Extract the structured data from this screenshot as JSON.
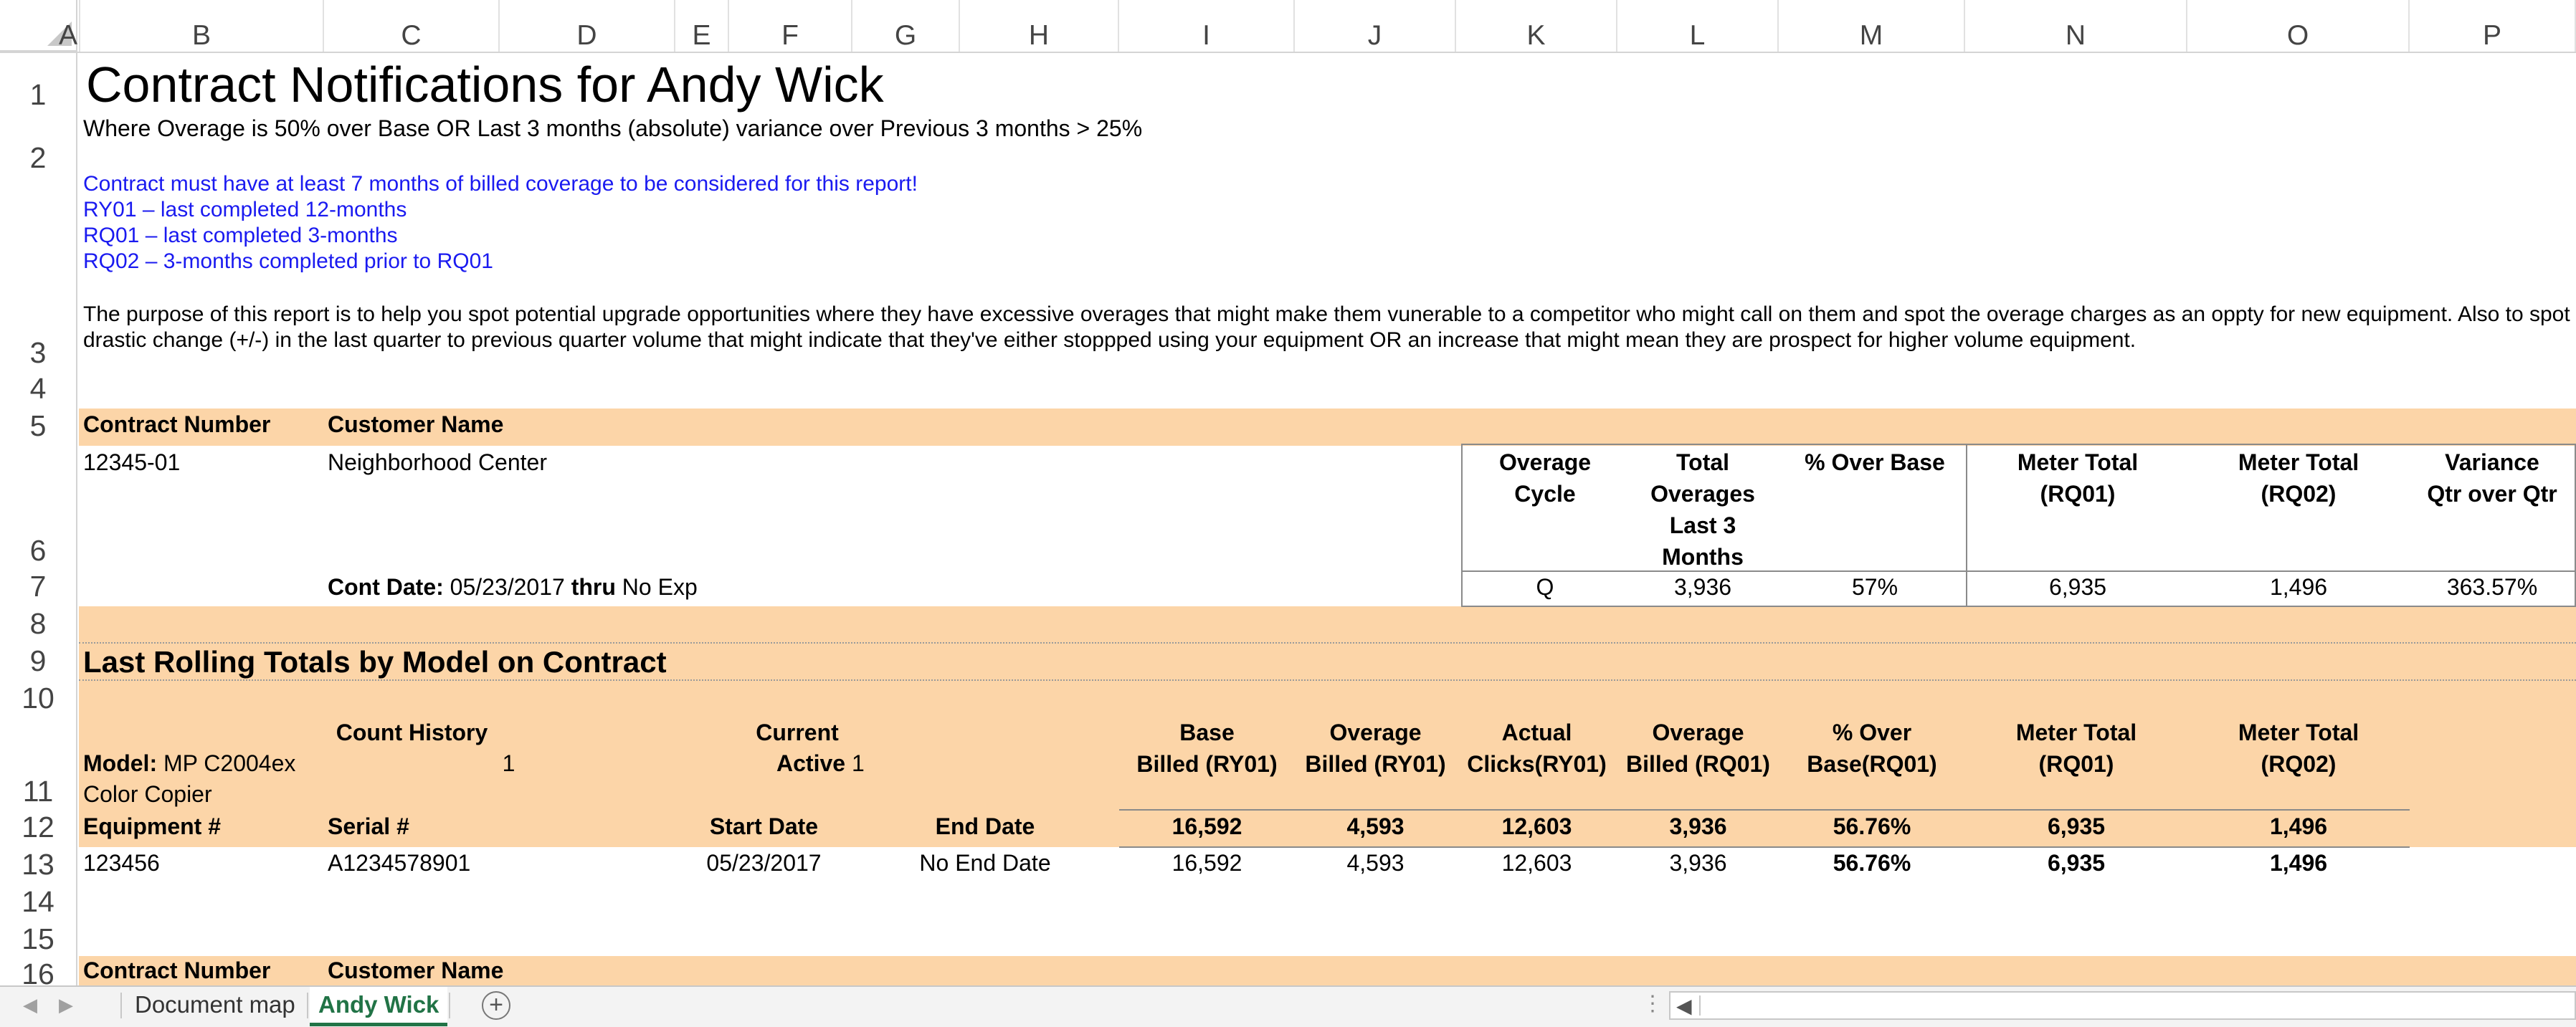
{
  "columns": [
    "A",
    "B",
    "C",
    "D",
    "E",
    "F",
    "G",
    "H",
    "I",
    "J",
    "K",
    "L",
    "M",
    "N",
    "O",
    "P"
  ],
  "rows": [
    "1",
    "2",
    "3",
    "4",
    "5",
    "6",
    "7",
    "8",
    "9",
    "10",
    "11",
    "12",
    "13",
    "14",
    "15",
    "16"
  ],
  "report": {
    "title": "Contract Notifications for Andy Wick",
    "criteria": "Where Overage is 50% over Base OR Last 3 months (absolute) variance over Previous 3 months > 25%",
    "notes": [
      "Contract must have at least 7 months of billed coverage to be considered for this report!",
      "RY01 – last completed 12-months",
      "RQ01 – last completed 3-months",
      "RQ02 – 3-months completed prior to RQ01"
    ],
    "purpose_line1": "The purpose of this report is to help you spot potential upgrade opportunities where they have excessive overages that might make them vunerable to a competitor who might call on them and spot the overage charges as an oppty for new equipment.  Also to spot any",
    "purpose_line2": "drastic change (+/-) in the last quarter to previous quarter volume that might indicate that they've either stoppped using your equipment OR an increase that might mean they are prospect for higher volume equipment."
  },
  "contract": {
    "hdr_number": "Contract Number",
    "hdr_customer": "Customer Name",
    "number": "12345-01",
    "customer": "Neighborhood Center",
    "cont_date_label": "Cont Date:",
    "cont_date": "05/23/2017",
    "thru_label": "thru",
    "end": "No Exp",
    "summary_headers": {
      "cycle": [
        "Overage",
        "Cycle"
      ],
      "total_overages": [
        "Total",
        "Overages",
        "Last 3",
        "Months"
      ],
      "pct_over_base": [
        "% Over Base"
      ],
      "meter_rq01": [
        "Meter Total",
        "(RQ01)"
      ],
      "meter_rq02": [
        "Meter Total",
        "(RQ02)"
      ],
      "variance": [
        "Variance",
        "Qtr over Qtr"
      ]
    },
    "summary_values": {
      "cycle": "Q",
      "total_overages": "3,936",
      "pct_over_base": "57%",
      "meter_rq01": "6,935",
      "meter_rq02": "1,496",
      "variance": "363.57%"
    }
  },
  "rolling": {
    "title": "Last Rolling Totals by Model on Contract",
    "count_history_label": "Count History",
    "current_label": "Current",
    "active_label": "Active",
    "model_label": "Model:",
    "model": "MP C2004ex",
    "count_history_value": "1",
    "active_value": "1",
    "model_desc": "Color Copier",
    "headers": {
      "base": [
        "Base",
        "Billed (RY01)"
      ],
      "overage_ry01": [
        "Overage",
        "Billed (RY01)"
      ],
      "actual": [
        "Actual",
        "Clicks(RY01)"
      ],
      "overage_rq01": [
        "Overage",
        "Billed (RQ01)"
      ],
      "pct_over": [
        "% Over",
        "Base(RQ01)"
      ],
      "meter_rq01": [
        "Meter Total",
        "(RQ01)"
      ],
      "meter_rq02": [
        "Meter Total",
        "(RQ02)"
      ]
    },
    "col_labels": {
      "equipment": "Equipment #",
      "serial": "Serial #",
      "start": "Start Date",
      "end": "End Date"
    },
    "totals": {
      "base": "16,592",
      "overage_ry01": "4,593",
      "actual": "12,603",
      "overage_rq01": "3,936",
      "pct_over": "56.76%",
      "meter_rq01": "6,935",
      "meter_rq02": "1,496"
    },
    "item": {
      "equipment": "123456",
      "serial": "A1234578901",
      "start": "05/23/2017",
      "end": "No End Date",
      "base": "16,592",
      "overage_ry01": "4,593",
      "actual": "12,603",
      "overage_rq01": "3,936",
      "pct_over": "56.76%",
      "meter_rq01": "6,935",
      "meter_rq02": "1,496"
    }
  },
  "next_contract": {
    "hdr_number": "Contract Number",
    "hdr_customer": "Customer Name"
  },
  "tabs": [
    {
      "label": "Document map",
      "active": false
    },
    {
      "label": "Andy Wick",
      "active": true
    }
  ],
  "colors": {
    "band": "#fcd5a8",
    "notes": "#1a1af0",
    "active_tab": "#217346"
  }
}
